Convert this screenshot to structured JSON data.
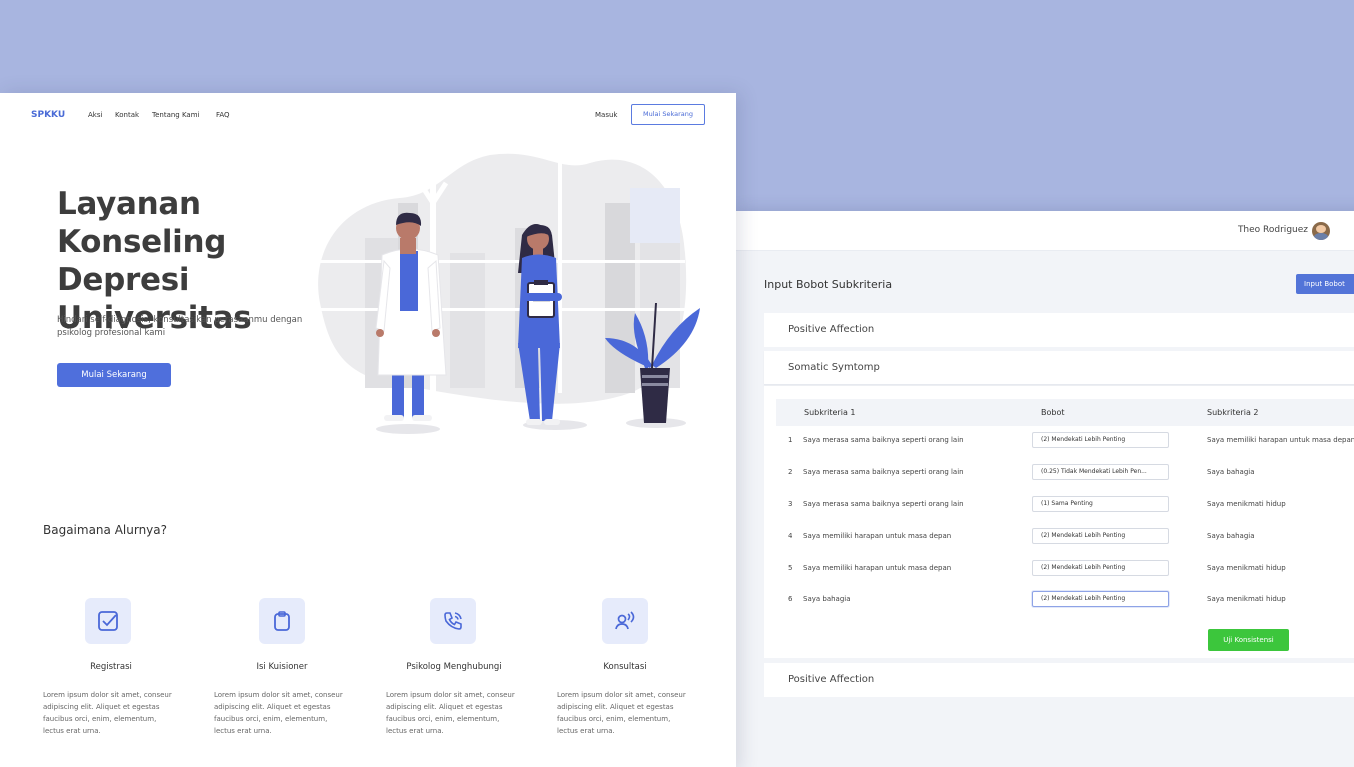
{
  "landing": {
    "nav": {
      "logo": "SPKKU",
      "links": [
        "Aksi",
        "Kontak",
        "Tentang Kami",
        "FAQ"
      ],
      "login": "Masuk",
      "cta": "Mulai Sekarang"
    },
    "hero": {
      "title": "Layanan\nKonseling Depresi\nUniversitas",
      "subtitle": "Hindari self-diagnosis, konsultasikan perasaanmu dengan psikolog profesional kami",
      "button": "Mulai Sekarang"
    },
    "flow": {
      "title": "Bagaimana Alurnya?",
      "steps": [
        {
          "icon": "checkbox-icon",
          "name": "Registrasi",
          "desc": "Lorem ipsum dolor sit amet, conseur adipiscing elit. Aliquet et egestas faucibus orci, enim, elementum, lectus erat urna."
        },
        {
          "icon": "clipboard-icon",
          "name": "Isi Kuisioner",
          "desc": "Lorem ipsum dolor sit amet, conseur adipiscing elit. Aliquet et egestas faucibus orci, enim, elementum, lectus erat urna."
        },
        {
          "icon": "phone-call-icon",
          "name": "Psikolog Menghubungi",
          "desc": "Lorem ipsum dolor sit amet, conseur adipiscing elit. Aliquet et egestas faucibus orci, enim, elementum, lectus erat urna."
        },
        {
          "icon": "users-sound-icon",
          "name": "Konsultasi",
          "desc": "Lorem ipsum dolor sit amet, conseur adipiscing elit. Aliquet et egestas faucibus orci, enim, elementum, lectus erat urna."
        }
      ]
    }
  },
  "admin": {
    "user_name": "Theo Rodriguez",
    "page_title": "Input Bobot Subkriteria",
    "input_button": "Input Bobot",
    "accordions": [
      "Positive Affection",
      "Somatic Symtomp",
      "Positive Affection"
    ],
    "table": {
      "headers": [
        "Subkriteria 1",
        "Bobot",
        "Subkriteria 2"
      ],
      "rows": [
        {
          "no": "1",
          "s1": "Saya merasa sama baiknya seperti orang lain",
          "bobot": "(2) Mendekati Lebih Penting",
          "s2": "Saya memiliki harapan untuk masa depan"
        },
        {
          "no": "2",
          "s1": "Saya merasa sama baiknya seperti orang lain",
          "bobot": "(0.25) Tidak Mendekati Lebih Pen...",
          "s2": "Saya bahagia"
        },
        {
          "no": "3",
          "s1": "Saya merasa sama baiknya seperti orang lain",
          "bobot": "(1) Sama Penting",
          "s2": "Saya menikmati hidup"
        },
        {
          "no": "4",
          "s1": "Saya memiliki harapan untuk masa depan",
          "bobot": "(2) Mendekati Lebih Penting",
          "s2": "Saya bahagia"
        },
        {
          "no": "5",
          "s1": "Saya memiliki harapan untuk masa depan",
          "bobot": "(2) Mendekati Lebih Penting",
          "s2": "Saya menikmati hidup"
        },
        {
          "no": "6",
          "s1": "Saya bahagia",
          "bobot": "(2) Mendekati Lebih Penting",
          "s2": "Saya menikmati hidup"
        }
      ]
    },
    "test_button": "Uji Konsistensi"
  },
  "colors": {
    "background": "#a8b5e0",
    "primary": "#4f6fdc",
    "success": "#3cc63c",
    "uniform": "#4a68d8",
    "dark": "#2f2b45"
  }
}
